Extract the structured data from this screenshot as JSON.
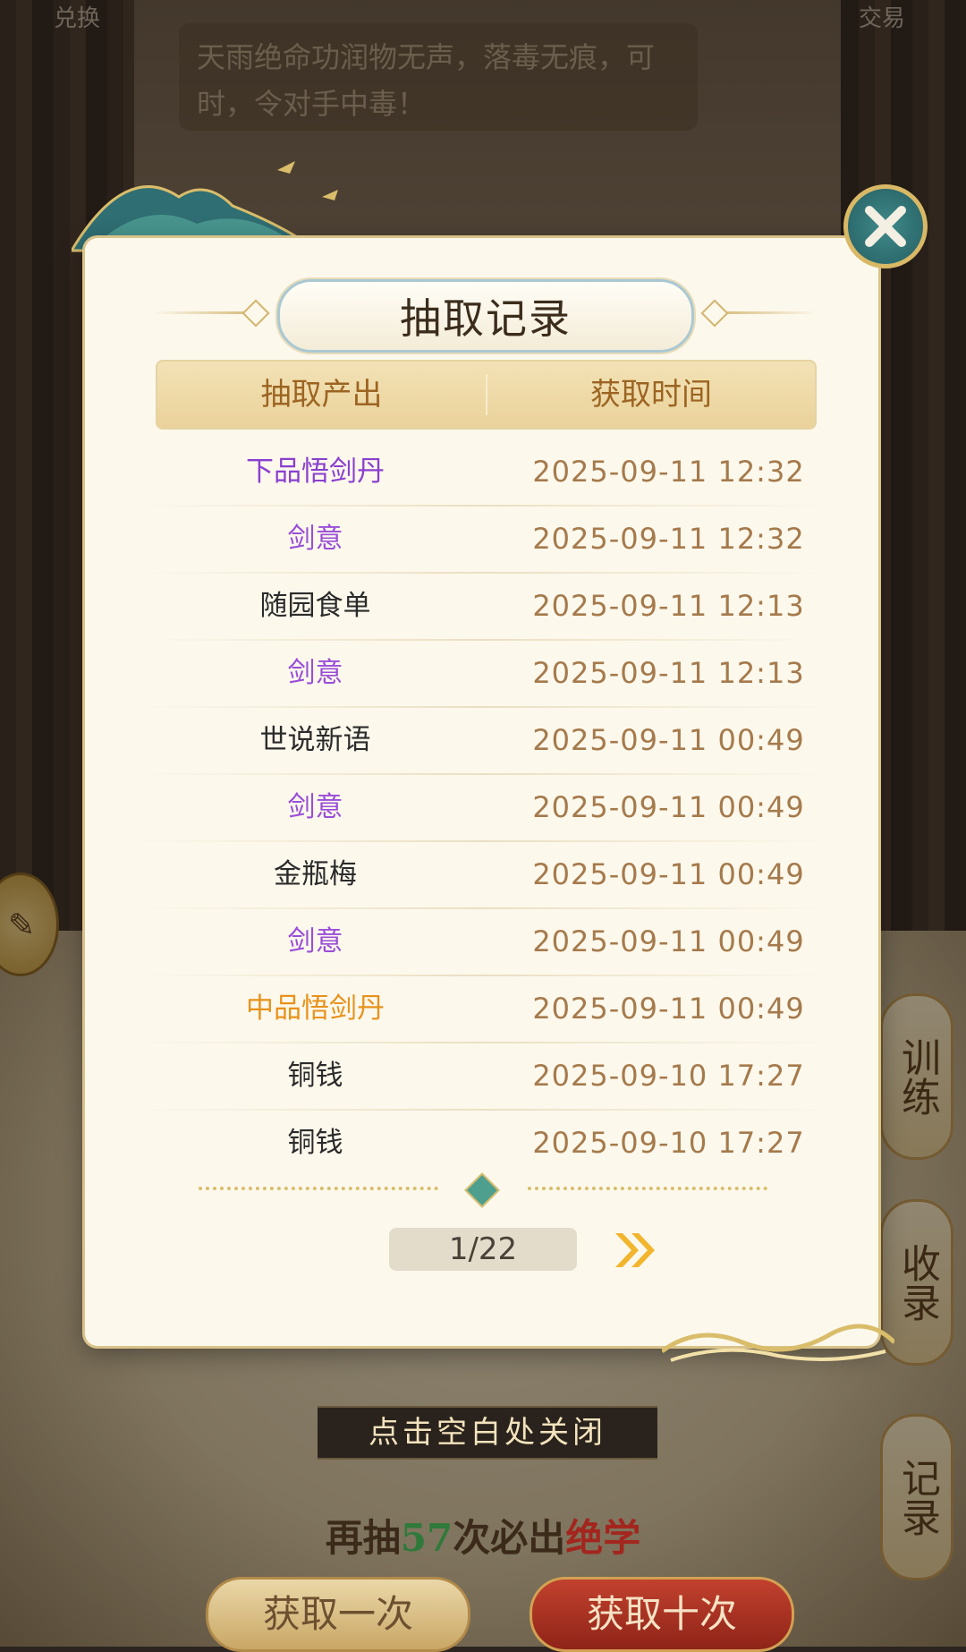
{
  "background": {
    "top_left_label": "兑换",
    "top_right_label": "交易",
    "quote": "天雨绝命功润物无声，落毒无痕，可        时，令对手中毒！"
  },
  "side_buttons": [
    {
      "label": "训练"
    },
    {
      "label": "收录"
    },
    {
      "label": "记录"
    }
  ],
  "modal": {
    "title": "抽取记录",
    "columns": {
      "item": "抽取产出",
      "time": "获取时间"
    },
    "rows": [
      {
        "item": "下品悟剑丹",
        "time": "2025-09-11   12:32",
        "color": "#8a3fd0"
      },
      {
        "item": "剑意",
        "time": "2025-09-11   12:32",
        "color": "#9a4ed8"
      },
      {
        "item": "随园食单",
        "time": "2025-09-11   12:13",
        "color": "#2b2b2b"
      },
      {
        "item": "剑意",
        "time": "2025-09-11   12:13",
        "color": "#9a4ed8"
      },
      {
        "item": "世说新语",
        "time": "2025-09-11   00:49",
        "color": "#2b2b2b"
      },
      {
        "item": "剑意",
        "time": "2025-09-11   00:49",
        "color": "#9a4ed8"
      },
      {
        "item": "金瓶梅",
        "time": "2025-09-11   00:49",
        "color": "#2b2b2b"
      },
      {
        "item": "剑意",
        "time": "2025-09-11   00:49",
        "color": "#9a4ed8"
      },
      {
        "item": "中品悟剑丹",
        "time": "2025-09-11   00:49",
        "color": "#e8921c"
      },
      {
        "item": "铜钱",
        "time": "2025-09-10   17:27",
        "color": "#2b2b2b"
      },
      {
        "item": "铜钱",
        "time": "2025-09-10   17:27",
        "color": "#2b2b2b"
      }
    ],
    "pagination": "1/22"
  },
  "close_hint": "点击空白处关闭",
  "guarantee": {
    "prefix": "再抽",
    "count": "57",
    "middle": "次必出",
    "reward": "绝学"
  },
  "buttons": {
    "draw_once": "获取一次",
    "draw_ten": "获取十次"
  },
  "colors": {
    "accent": "#d9bd6a",
    "close_button": "#2d6b6e"
  },
  "icons": {
    "close": "close-x-icon",
    "next": "double-chevron-right-icon",
    "chat": "chat-bubble-icon"
  }
}
